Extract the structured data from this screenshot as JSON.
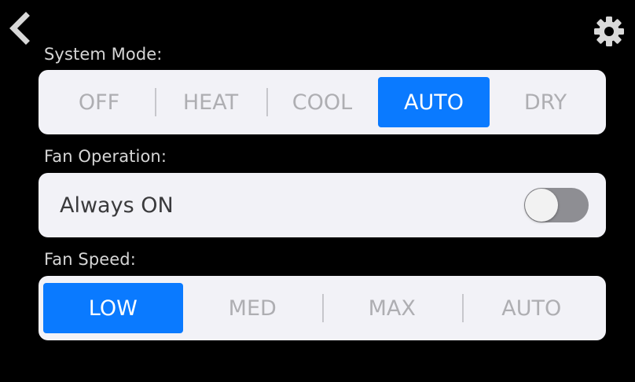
{
  "header": {
    "back_icon": "chevron-left-icon",
    "settings_icon": "gear-icon"
  },
  "system_mode": {
    "label": "System Mode:",
    "options": [
      "OFF",
      "HEAT",
      "COOL",
      "AUTO",
      "DRY"
    ],
    "selected": "AUTO"
  },
  "fan_operation": {
    "label": "Fan Operation:",
    "setting_label": "Always ON",
    "toggle_on": false
  },
  "fan_speed": {
    "label": "Fan Speed:",
    "options": [
      "LOW",
      "MED",
      "MAX",
      "AUTO"
    ],
    "selected": "LOW"
  },
  "colors": {
    "background": "#000000",
    "accent": "#0a7aff",
    "panel": "#f2f2f7",
    "inactive_text": "#aeaeb2",
    "label_text": "#d6d6d6"
  }
}
